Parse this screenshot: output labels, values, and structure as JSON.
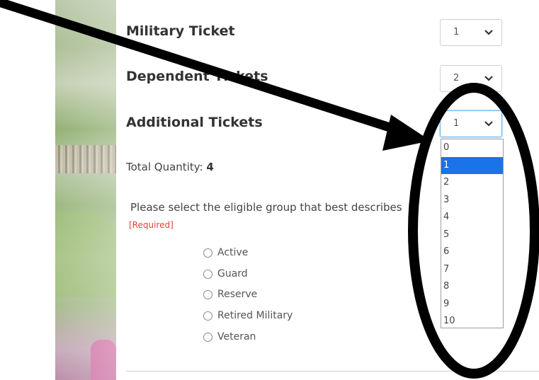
{
  "tickets": {
    "military": {
      "label": "Military Ticket",
      "value": "1"
    },
    "dependent": {
      "label": "Dependent Tickets",
      "value": "2"
    },
    "additional": {
      "label": "Additional Tickets",
      "value": "1"
    }
  },
  "total": {
    "label": "Total Quantity: ",
    "value": "4"
  },
  "eligibility": {
    "prompt": "Please select the eligible group that best describes",
    "required": "[Required]",
    "options": [
      "Active",
      "Guard",
      "Reserve",
      "Retired Military",
      "Veteran"
    ]
  },
  "dropdown": {
    "options": [
      "0",
      "1",
      "2",
      "3",
      "4",
      "5",
      "6",
      "7",
      "8",
      "9",
      "10"
    ],
    "selected_index": 1
  },
  "annotation": {
    "arrow_color": "#000000",
    "ellipse_color": "#000000"
  },
  "colors": {
    "highlight": "#1a73e8",
    "required": "#e0433a"
  }
}
